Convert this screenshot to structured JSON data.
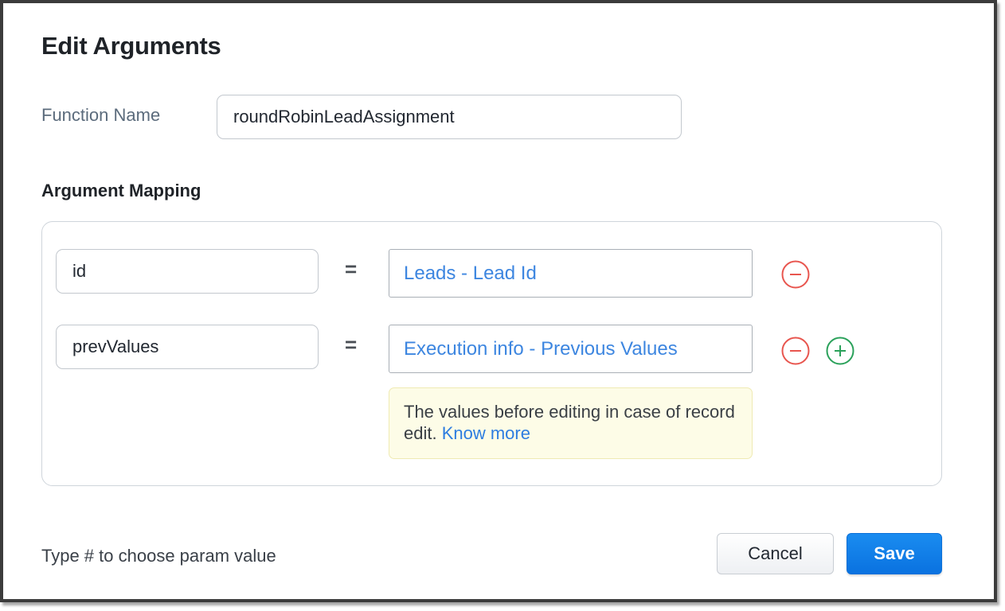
{
  "dialog": {
    "title": "Edit Arguments"
  },
  "function": {
    "label": "Function Name",
    "value": "roundRobinLeadAssignment"
  },
  "mapping": {
    "title": "Argument Mapping",
    "equals": "=",
    "rows": [
      {
        "argument": "id",
        "value": "Leads - Lead Id",
        "actions": [
          "remove-icon"
        ]
      },
      {
        "argument": "prevValues",
        "value": "Execution info - Previous Values",
        "actions": [
          "remove-icon",
          "add-icon"
        ]
      }
    ],
    "hint": {
      "text": "The values before editing in case of record edit.",
      "link": "Know more"
    }
  },
  "footer": {
    "note": "Type # to choose param value",
    "cancel_label": "Cancel",
    "save_label": "Save"
  },
  "colors": {
    "accent": "#0a72e0",
    "link": "#3d86e0",
    "remove": "#e8554e",
    "add": "#2aa15a",
    "hint_bg": "#fdfce7"
  }
}
